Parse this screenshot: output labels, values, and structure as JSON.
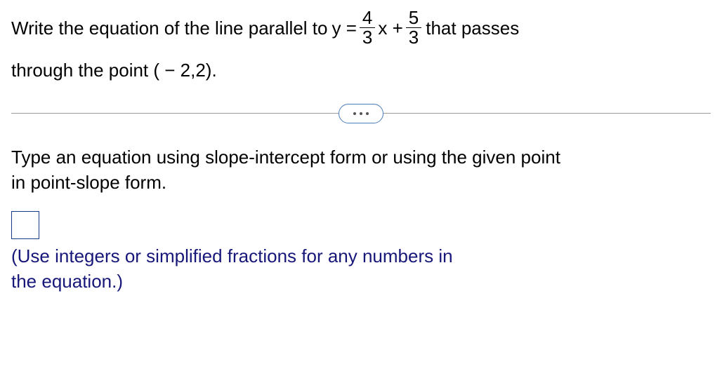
{
  "question": {
    "prefix": "Write the equation of the line parallel to ",
    "expr_left": "y =",
    "frac1": {
      "num": "4",
      "den": "3"
    },
    "mid_x": "x +",
    "frac2": {
      "num": "5",
      "den": "3"
    },
    "suffix_after_frac": " that passes",
    "line2": "through the point ( − 2,2)."
  },
  "divider": {
    "dots": "..."
  },
  "instructions": {
    "line1": "Type an equation using slope-intercept form or using the given point",
    "line2": "in point-slope form."
  },
  "answer": {
    "value": ""
  },
  "helper": {
    "line1": "(Use integers or simplified fractions for any numbers in",
    "line2": "the equation.)"
  }
}
